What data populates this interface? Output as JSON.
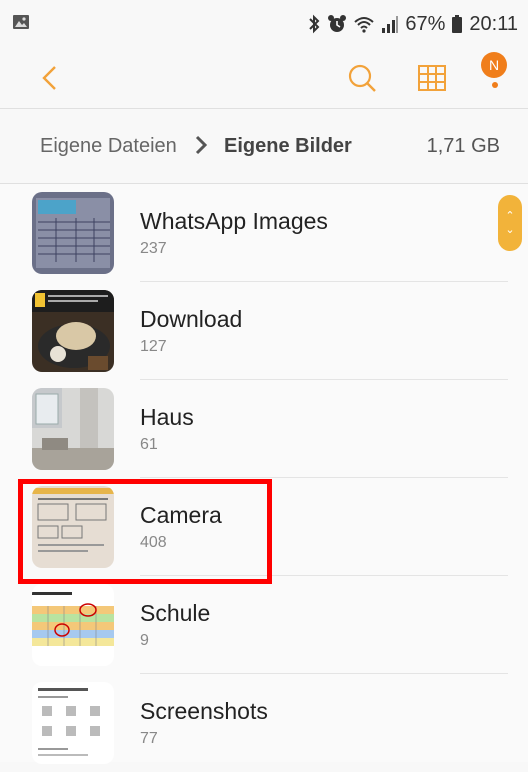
{
  "status_bar": {
    "battery_percent": "67%",
    "time": "20:11"
  },
  "breadcrumb": {
    "root": "Eigene Dateien",
    "current": "Eigene Bilder",
    "size": "1,71 GB"
  },
  "notification_badge": "N",
  "folders": [
    {
      "name": "WhatsApp Images",
      "count": "237"
    },
    {
      "name": "Download",
      "count": "127"
    },
    {
      "name": "Haus",
      "count": "61"
    },
    {
      "name": "Camera",
      "count": "408"
    },
    {
      "name": "Schule",
      "count": "9"
    },
    {
      "name": "Screenshots",
      "count": "77"
    }
  ],
  "colors": {
    "accent": "#f2a23a",
    "highlight": "#ff0000"
  }
}
